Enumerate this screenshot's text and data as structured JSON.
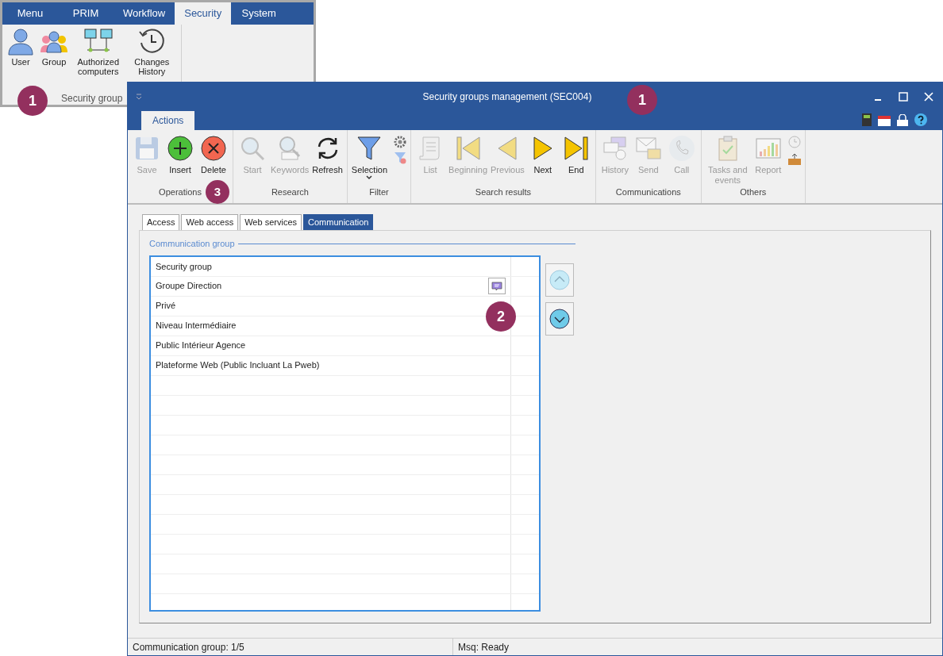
{
  "back_ribbon": {
    "tabs": [
      {
        "label": "Menu",
        "selected": false
      },
      {
        "label": "PRIM",
        "selected": false
      },
      {
        "label": "Workflow",
        "selected": false
      },
      {
        "label": "Security",
        "selected": true
      },
      {
        "label": "System",
        "selected": false
      }
    ],
    "buttons": [
      {
        "label": "User"
      },
      {
        "label": "Group"
      },
      {
        "label": "Authorized computers"
      },
      {
        "label": "Changes History"
      }
    ],
    "group_label": "Security group"
  },
  "window": {
    "title": "Security groups management (SEC004)",
    "ribbon_tabs": [
      {
        "label": "Actions",
        "selected": true
      }
    ],
    "ribbon_groups": [
      {
        "label": "Operations",
        "buttons": [
          {
            "label": "Save",
            "disabled": true
          },
          {
            "label": "Insert",
            "disabled": false
          },
          {
            "label": "Delete",
            "disabled": false
          }
        ]
      },
      {
        "label": "Research",
        "buttons": [
          {
            "label": "Start",
            "disabled": true
          },
          {
            "label": "Keywords",
            "disabled": true
          },
          {
            "label": "Refresh",
            "disabled": false
          }
        ]
      },
      {
        "label": "Filter",
        "buttons": [
          {
            "label": "Selection",
            "disabled": false
          }
        ]
      },
      {
        "label": "Search results",
        "buttons": [
          {
            "label": "List",
            "disabled": true
          },
          {
            "label": "Beginning",
            "disabled": true
          },
          {
            "label": "Previous",
            "disabled": true
          },
          {
            "label": "Next",
            "disabled": false
          },
          {
            "label": "End",
            "disabled": false
          }
        ]
      },
      {
        "label": "Communications",
        "buttons": [
          {
            "label": "History",
            "disabled": true
          },
          {
            "label": "Send",
            "disabled": true
          },
          {
            "label": "Call",
            "disabled": true
          }
        ]
      },
      {
        "label": "Others",
        "buttons": [
          {
            "label": "Tasks and events",
            "disabled": true
          },
          {
            "label": "Report",
            "disabled": true
          }
        ]
      }
    ],
    "form_tabs": [
      {
        "label": "Access",
        "selected": false
      },
      {
        "label": "Web access",
        "selected": false
      },
      {
        "label": "Web services",
        "selected": false
      },
      {
        "label": "Communication",
        "selected": true
      }
    ],
    "fieldset_title": "Communication group",
    "grid": {
      "header": "Security group",
      "rows": [
        {
          "label": "Groupe Direction",
          "has_note": true
        },
        {
          "label": "Privé",
          "has_note": false
        },
        {
          "label": "Niveau Intermédiaire",
          "has_note": false
        },
        {
          "label": "Public Intérieur Agence",
          "has_note": false
        },
        {
          "label": "Plateforme Web (Public Incluant La Pweb)",
          "has_note": false
        }
      ]
    },
    "move_buttons": [
      {
        "disabled": true
      },
      {
        "disabled": false
      }
    ],
    "status_bar": [
      "Communication group: 1/5",
      "Msq: Ready"
    ]
  },
  "callouts": [
    "1",
    "1",
    "2",
    "3"
  ]
}
